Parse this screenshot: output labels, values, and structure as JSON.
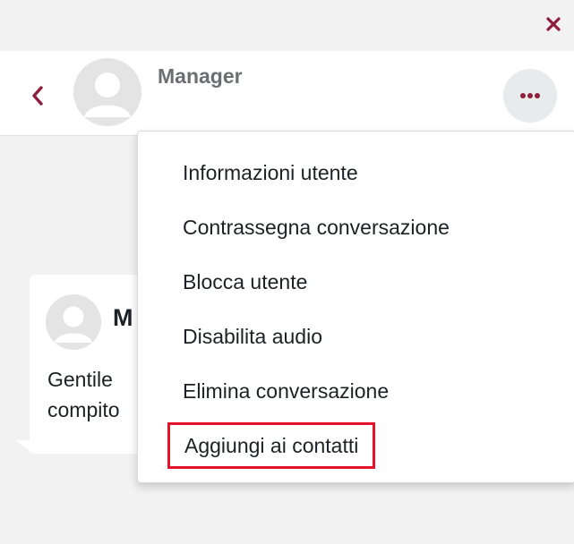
{
  "header": {
    "contact_name": "Manager"
  },
  "message": {
    "sender": "M",
    "lines": [
      "Gentile",
      "compito"
    ]
  },
  "menu": {
    "items": [
      "Informazioni utente",
      "Contrassegna conversazione",
      "Blocca utente",
      "Disabilita audio",
      "Elimina conversazione",
      "Aggiungi ai contatti"
    ],
    "highlighted_index": 5
  },
  "icons": {
    "close": "close-icon",
    "back": "chevron-left-icon",
    "more": "ellipsis-icon",
    "avatar": "user-avatar-icon"
  },
  "colors": {
    "accent": "#8f1d3d",
    "highlight_border": "#e4132a"
  }
}
